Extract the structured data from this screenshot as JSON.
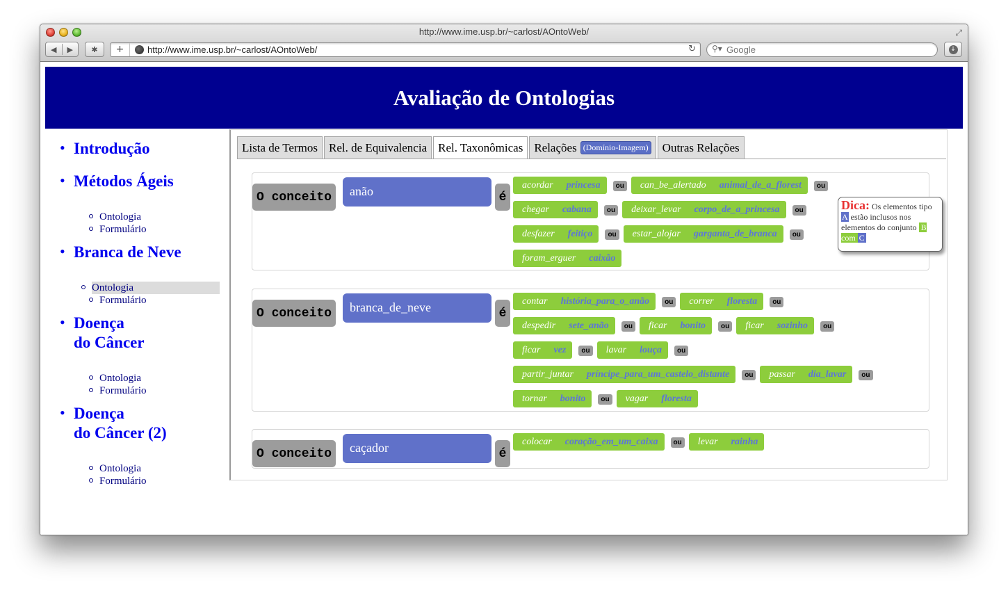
{
  "browser": {
    "window_title": "http://www.ime.usp.br/~carlost/AOntoWeb/",
    "url": "http://www.ime.usp.br/~carlost/AOntoWeb/",
    "search_placeholder": "Google",
    "nav_back": "◀",
    "nav_forward": "▶",
    "add_label": "+",
    "reload_icon": "↻"
  },
  "header": {
    "title": "Avaliação de Ontologias"
  },
  "sidebar": {
    "sections": [
      {
        "title": "Introdução",
        "subs": []
      },
      {
        "title": "Métodos Ágeis",
        "subs": [
          "Ontologia",
          "Formulário"
        ]
      },
      {
        "title": "Branca de Neve",
        "subs": [
          "Ontologia",
          "Formulário"
        ]
      },
      {
        "title_line1": "Doença",
        "title_line2": "do Câncer",
        "subs": [
          "Ontologia",
          "Formulário"
        ]
      },
      {
        "title_line1": "Doença",
        "title_line2": "do Câncer (2)",
        "subs": [
          "Ontologia",
          "Formulário"
        ]
      }
    ],
    "active": "Branca de Neve / Ontologia"
  },
  "tabs": [
    {
      "label": "Lista de Termos"
    },
    {
      "label": "Rel. de Equivalencia"
    },
    {
      "label": "Rel. Taxonômicas",
      "active": true
    },
    {
      "label": "Relações",
      "badge": "(Domínio-Imagem)"
    },
    {
      "label": "Outras Relações"
    }
  ],
  "concept_label": "O conceito",
  "is_label": "é",
  "or_label": "ou",
  "concepts": [
    {
      "name": "anão",
      "rows": [
        [
          [
            "acordar",
            "princesa"
          ],
          [
            "can_be_alertado",
            "animal_de_a_florest"
          ]
        ],
        [
          [
            "chegar",
            "cabana"
          ],
          [
            "deixar_levar",
            "corpo_de_a_princesa"
          ]
        ],
        [
          [
            "desfazer",
            "feitiço"
          ],
          [
            "estar_alojar",
            "garganta_de_branca"
          ]
        ],
        [
          [
            "foram_erguer",
            "caixão"
          ]
        ]
      ]
    },
    {
      "name": "branca_de_neve",
      "rows": [
        [
          [
            "contar",
            "história_para_o_anão"
          ],
          [
            "correr",
            "floresta"
          ]
        ],
        [
          [
            "despedir",
            "sete_anão"
          ],
          [
            "ficar",
            "bonito"
          ],
          [
            "ficar",
            "sozinho"
          ]
        ],
        [
          [
            "ficar",
            "vez"
          ],
          [
            "lavar",
            "louça"
          ]
        ],
        [
          [
            "partir_juntar",
            "príncipe_para_um_castelo_distante"
          ],
          [
            "passar",
            "dia_lavar"
          ]
        ],
        [
          [
            "tornar",
            "bonito"
          ],
          [
            "vagar",
            "floresta"
          ]
        ]
      ]
    },
    {
      "name": "caçador",
      "rows": [
        [
          [
            "colocar",
            "coração_em_um_caixa"
          ],
          [
            "levar",
            "rainha"
          ]
        ]
      ]
    }
  ],
  "tooltip": {
    "head": "Dica:",
    "text1": "Os elementos tipo",
    "a": "A",
    "text2": "estão inclusos nos elementos do conjunto",
    "b": "B com",
    "c": "C"
  },
  "colors": {
    "header_bg": "#000090",
    "link": "#0000ee",
    "concept_name_bg": "#6071c9",
    "relation_bg": "#8dcd3c",
    "relation_object": "#5c76d8",
    "label_gray": "#9c9c9c",
    "tooltip_head": "#e83030"
  }
}
